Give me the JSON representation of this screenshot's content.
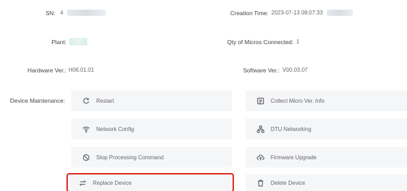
{
  "info": {
    "sn_label": "SN:",
    "sn_value": "4",
    "creation_time_label": "Creation Time:",
    "creation_time_value": "2023-07-13 08:07:33",
    "plant_label": "Plant:",
    "qty_micros_label": "Qty of Micros Connected:",
    "qty_micros_value": "1",
    "hardware_ver_label": "Hardware Ver.:",
    "hardware_ver_value": "H06.01.01",
    "software_ver_label": "Software Ver.:",
    "software_ver_value": "V00.03.07"
  },
  "maintenance": {
    "label": "Device Maintenance:",
    "buttons": [
      {
        "label": "Restart",
        "icon": "restart-icon"
      },
      {
        "label": "Collect Micro Ver. Info",
        "icon": "collect-info-icon"
      },
      {
        "label": "Network Config",
        "icon": "wifi-icon"
      },
      {
        "label": "DTU Networking",
        "icon": "network-nodes-icon"
      },
      {
        "label": "Stop Processing Command",
        "icon": "stop-icon"
      },
      {
        "label": "Firmware Upgrade",
        "icon": "upgrade-icon"
      },
      {
        "label": "Replace Device",
        "icon": "replace-icon"
      },
      {
        "label": "Delete Device",
        "icon": "delete-icon"
      }
    ]
  },
  "colors": {
    "highlight_border": "#e2231a",
    "button_bg": "#f5f6f8"
  }
}
